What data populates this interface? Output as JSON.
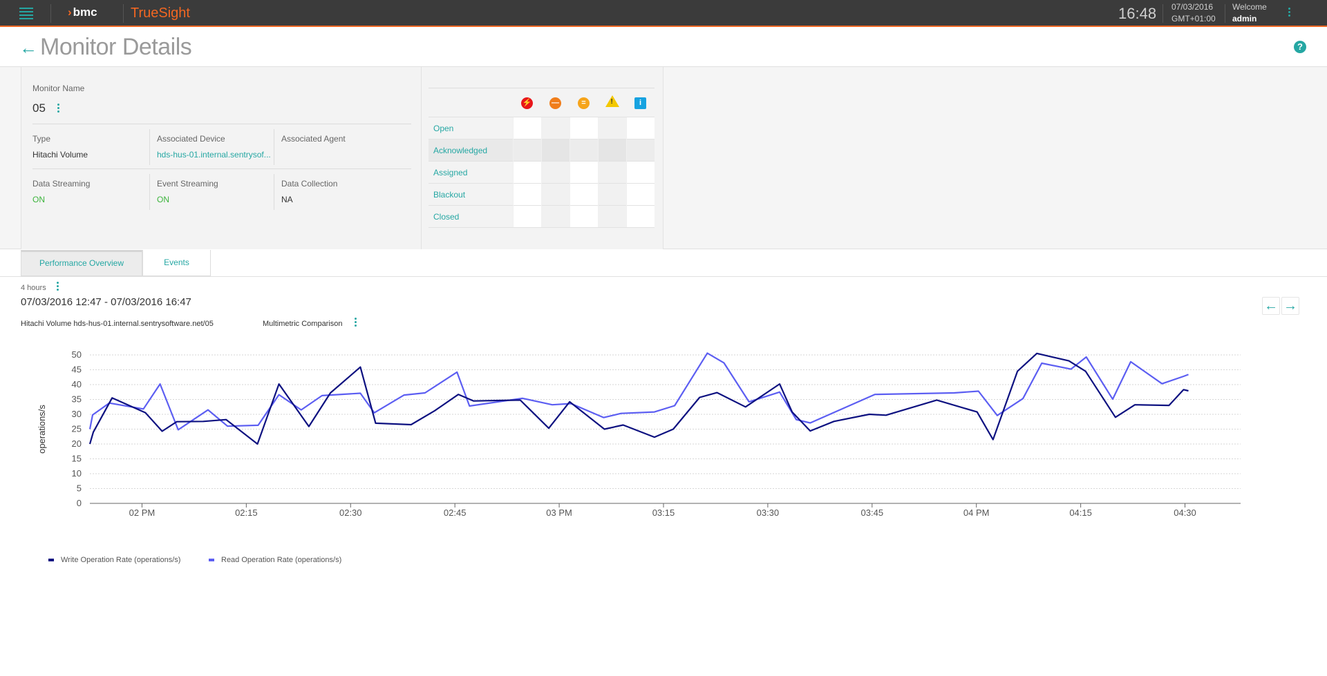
{
  "topbar": {
    "brand": "bmc",
    "product": "TrueSight",
    "time": "16:48",
    "date": "07/03/2016",
    "timezone": "GMT+01:00",
    "welcome_label": "Welcome",
    "user": "admin",
    "accent_color": "#f26722"
  },
  "page": {
    "title": "Monitor Details"
  },
  "monitor": {
    "name_label": "Monitor Name",
    "name": "05",
    "type_label": "Type",
    "type": "Hitachi Volume",
    "device_label": "Associated Device",
    "device": "hds-hus-01.internal.sentrysof...",
    "agent_label": "Associated Agent",
    "agent": "",
    "data_streaming_label": "Data Streaming",
    "data_streaming": "ON",
    "event_streaming_label": "Event Streaming",
    "event_streaming": "ON",
    "data_collection_label": "Data Collection",
    "data_collection": "NA"
  },
  "event_status": {
    "severity_icons": [
      "critical-icon",
      "major-icon",
      "minor-icon",
      "warning-icon",
      "info-icon"
    ],
    "severity_colors": [
      "#e8161b",
      "#f07d1a",
      "#f6a41a",
      "#f3c800",
      "#16a2e0"
    ],
    "rows": [
      "Open",
      "Acknowledged",
      "Assigned",
      "Blackout",
      "Closed"
    ]
  },
  "tabs": [
    {
      "label": "Performance Overview",
      "active": true
    },
    {
      "label": "Events",
      "active": false
    }
  ],
  "chart_header": {
    "range": "4 hours",
    "date_range": "07/03/2016 12:47 - 07/03/2016 16:47",
    "source": "Hitachi Volume hds-hus-01.internal.sentrysoftware.net/05",
    "comparison": "Multimetric Comparison"
  },
  "chart_data": {
    "type": "line",
    "ylabel": "operations/s",
    "xlabel": "",
    "ylim": [
      0,
      50
    ],
    "yticks": [
      0,
      5,
      10,
      15,
      20,
      25,
      30,
      35,
      40,
      45,
      50
    ],
    "xlim_minutes": [
      0,
      240
    ],
    "xticks": [
      {
        "t": 7.5,
        "label": "02 PM"
      },
      {
        "t": 22.5,
        "label": "02:15"
      },
      {
        "t": 37.5,
        "label": "02:30"
      },
      {
        "t": 52.5,
        "label": "02:45"
      },
      {
        "t": 67.5,
        "label": "03 PM"
      },
      {
        "t": 82.5,
        "label": "03:15"
      },
      {
        "t": 97.5,
        "label": "03:30"
      },
      {
        "t": 112.5,
        "label": "03:45"
      },
      {
        "t": 127.5,
        "label": "04 PM"
      },
      {
        "t": 142.5,
        "label": "04:15"
      },
      {
        "t": 157.5,
        "label": "04:30"
      }
    ],
    "grid": true,
    "legend_position": "bottom-left",
    "series": [
      {
        "name": "Write Operation Rate (operations/s)",
        "color": "#0d1180",
        "points": [
          [
            0,
            20
          ],
          [
            0.5,
            24
          ],
          [
            3.2,
            35.5
          ],
          [
            8,
            30.5
          ],
          [
            10.4,
            24.3
          ],
          [
            12.5,
            27.5
          ],
          [
            16.3,
            27.6
          ],
          [
            19.6,
            28.2
          ],
          [
            24.1,
            20
          ],
          [
            27.2,
            40.2
          ],
          [
            31.5,
            25.9
          ],
          [
            34.6,
            37.2
          ],
          [
            38.9,
            45.9
          ],
          [
            41.1,
            27
          ],
          [
            46.2,
            26.5
          ],
          [
            49.6,
            31.2
          ],
          [
            53,
            36.7
          ],
          [
            55.2,
            34.5
          ],
          [
            61.9,
            34.8
          ],
          [
            66,
            25.3
          ],
          [
            69,
            34.2
          ],
          [
            74,
            25
          ],
          [
            76.7,
            26.4
          ],
          [
            81.2,
            22.3
          ],
          [
            83.9,
            25
          ],
          [
            87.7,
            35.7
          ],
          [
            90.2,
            37.3
          ],
          [
            94.3,
            32.5
          ],
          [
            99.2,
            40.2
          ],
          [
            101,
            30.8
          ],
          [
            103.6,
            24.4
          ],
          [
            107,
            27.6
          ],
          [
            112.1,
            30
          ],
          [
            114.5,
            29.7
          ],
          [
            121.8,
            34.8
          ],
          [
            127.6,
            30.8
          ],
          [
            129.9,
            21.5
          ],
          [
            133.4,
            44.5
          ],
          [
            136.2,
            50.5
          ],
          [
            140.8,
            48
          ],
          [
            143.2,
            44.5
          ],
          [
            147.5,
            29
          ],
          [
            150.3,
            33.2
          ],
          [
            155.2,
            33
          ],
          [
            157.3,
            38.3
          ],
          [
            158,
            37.9
          ]
        ]
      },
      {
        "name": "Read Operation Rate (operations/s)",
        "color": "#5c5ef2",
        "points": [
          [
            0,
            25
          ],
          [
            0.4,
            29.8
          ],
          [
            2.8,
            33.8
          ],
          [
            7.7,
            31.8
          ],
          [
            10.1,
            40.2
          ],
          [
            12.7,
            24.8
          ],
          [
            17,
            31.5
          ],
          [
            19.8,
            26
          ],
          [
            24.2,
            26.3
          ],
          [
            27.2,
            36.6
          ],
          [
            30.4,
            31.5
          ],
          [
            33.4,
            36.3
          ],
          [
            38.9,
            37.1
          ],
          [
            40.9,
            30.5
          ],
          [
            45.2,
            36.5
          ],
          [
            48.2,
            37.2
          ],
          [
            52.8,
            44.2
          ],
          [
            54.6,
            32.8
          ],
          [
            62.2,
            35.4
          ],
          [
            66.5,
            33.2
          ],
          [
            69.2,
            33.6
          ],
          [
            73.9,
            28.9
          ],
          [
            76.4,
            30.3
          ],
          [
            81.2,
            30.8
          ],
          [
            84.1,
            32.9
          ],
          [
            88.8,
            50.6
          ],
          [
            91.2,
            47.3
          ],
          [
            94.8,
            34.2
          ],
          [
            99.2,
            37.5
          ],
          [
            101.6,
            28.2
          ],
          [
            103.6,
            27.1
          ],
          [
            112.9,
            36.7
          ],
          [
            124.3,
            37.2
          ],
          [
            127.8,
            37.8
          ],
          [
            130.5,
            29.6
          ],
          [
            134.2,
            35.3
          ],
          [
            136.9,
            47.2
          ],
          [
            141.1,
            45.2
          ],
          [
            143.3,
            49.3
          ],
          [
            147.1,
            35.1
          ],
          [
            149.7,
            47.7
          ],
          [
            154.2,
            40.3
          ],
          [
            157.3,
            42.8
          ],
          [
            158,
            43.4
          ]
        ]
      }
    ]
  }
}
